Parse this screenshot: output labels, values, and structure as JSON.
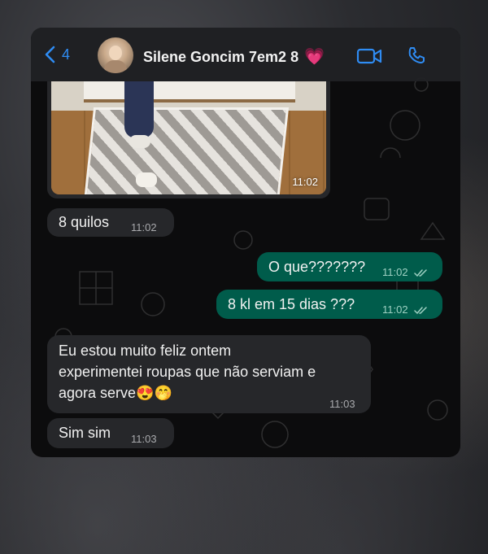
{
  "header": {
    "back_count": "4",
    "contact_name": "Silene Goncim 7em2 8",
    "name_emoji": "💗",
    "icons": [
      "chevron-left-icon",
      "video-call-icon",
      "phone-icon"
    ],
    "accent_color": "#2f8cf3"
  },
  "messages": [
    {
      "kind": "image",
      "direction": "incoming",
      "time": "11:02"
    },
    {
      "direction": "incoming",
      "text": "8 quilos",
      "time": "11:02"
    },
    {
      "direction": "outgoing",
      "text": "O que???????",
      "time": "11:02",
      "status": "read"
    },
    {
      "direction": "outgoing",
      "text": "8 kl em 15 dias ???",
      "time": "11:02",
      "status": "read"
    },
    {
      "direction": "incoming",
      "text": "Eu estou muito feliz  ontem\nexperimentei roupas que não serviam e\nagora serve😍🤭",
      "time": "11:03"
    },
    {
      "direction": "incoming",
      "text": "Sim sim",
      "time": "11:03"
    }
  ],
  "colors": {
    "incoming_bubble": "#26272a",
    "outgoing_bubble": "#005c4b",
    "chat_background": "#0c0c0d"
  }
}
